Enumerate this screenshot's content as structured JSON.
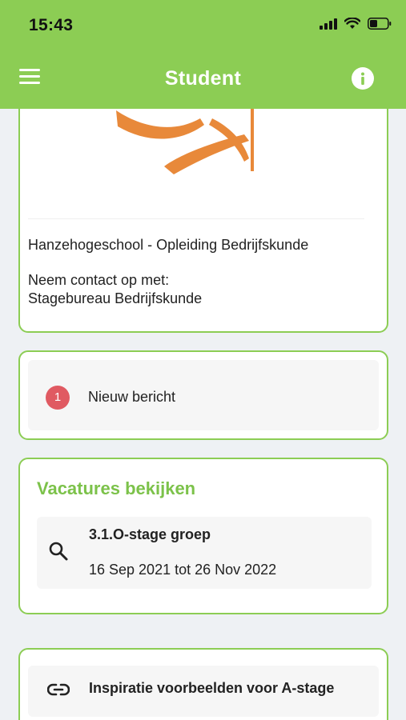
{
  "status_bar": {
    "time": "15:43"
  },
  "header": {
    "title": "Student"
  },
  "school_card": {
    "school_name": "Hanzehogeschool - Opleiding Bedrijfskunde",
    "contact_intro": "Neem contact op met:",
    "contact_name": "Stagebureau Bedrijfskunde"
  },
  "messages_card": {
    "badge_count": "1",
    "label": "Nieuw bericht"
  },
  "vacancies_card": {
    "title": "Vacatures bekijken",
    "item": {
      "name": "3.1.O-stage groep",
      "dates": "16 Sep 2021 tot 26 Nov 2022"
    }
  },
  "link_card": {
    "label": "Inspiratie voorbeelden voor A-stage"
  },
  "colors": {
    "accent": "#8ccd54",
    "title_green": "#7cc24a",
    "badge": "#e05a62",
    "logo_orange": "#e8893a"
  }
}
